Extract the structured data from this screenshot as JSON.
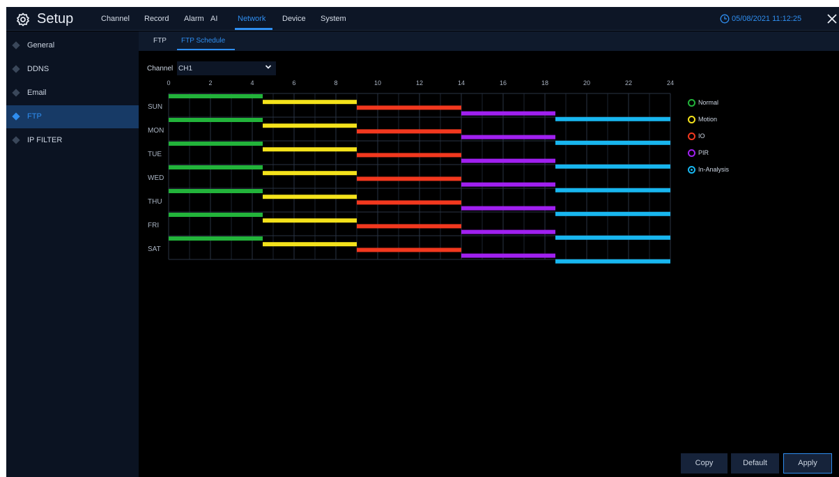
{
  "app": {
    "title": "Setup",
    "menu": [
      {
        "label": "Channel",
        "active": false
      },
      {
        "label": "Record",
        "active": false
      },
      {
        "label": "Alarm",
        "active": false
      },
      {
        "label": "AI",
        "active": false
      },
      {
        "label": "Network",
        "active": true
      },
      {
        "label": "Device",
        "active": false
      },
      {
        "label": "System",
        "active": false
      }
    ],
    "datetime": "05/08/2021 11:12:25",
    "accent_color": "#2f8ef0"
  },
  "sidebar": {
    "items": [
      {
        "label": "General",
        "active": false
      },
      {
        "label": "DDNS",
        "active": false
      },
      {
        "label": "Email",
        "active": false
      },
      {
        "label": "FTP",
        "active": true
      },
      {
        "label": "IP FILTER",
        "active": false
      }
    ]
  },
  "subtabs": [
    {
      "label": "FTP",
      "active": false
    },
    {
      "label": "FTP Schedule",
      "active": true
    }
  ],
  "channel": {
    "label": "Channel",
    "value": "CH1"
  },
  "schedule": {
    "days": [
      "SUN",
      "MON",
      "TUE",
      "WED",
      "THU",
      "FRI",
      "SAT"
    ],
    "hour_labels": [
      "0",
      "2",
      "4",
      "6",
      "8",
      "10",
      "12",
      "14",
      "16",
      "18",
      "20",
      "22",
      "24"
    ],
    "segments": [
      {
        "type": "Normal",
        "start": 0,
        "end": 4.5
      },
      {
        "type": "Motion",
        "start": 4.5,
        "end": 9
      },
      {
        "type": "IO",
        "start": 9,
        "end": 14
      },
      {
        "type": "PIR",
        "start": 14,
        "end": 18.5
      },
      {
        "type": "In-Analysis",
        "start": 18.5,
        "end": 24
      }
    ]
  },
  "legend": [
    {
      "label": "Normal",
      "color": "#22b33a",
      "selected": false
    },
    {
      "label": "Motion",
      "color": "#f4e21b",
      "selected": false
    },
    {
      "label": "IO",
      "color": "#f2381e",
      "selected": false
    },
    {
      "label": "PIR",
      "color": "#a020f0",
      "selected": false
    },
    {
      "label": "In-Analysis",
      "color": "#18b6ef",
      "selected": true
    }
  ],
  "buttons": {
    "copy": "Copy",
    "default": "Default",
    "apply": "Apply"
  }
}
